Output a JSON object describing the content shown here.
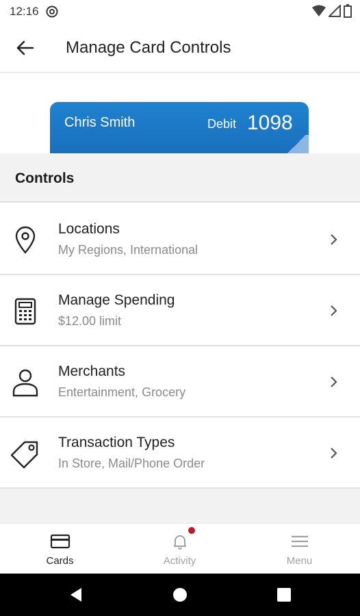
{
  "status_bar": {
    "time": "12:16"
  },
  "header": {
    "title": "Manage Card Controls"
  },
  "card": {
    "holder": "Chris Smith",
    "type": "Debit",
    "last4": "1098",
    "color": "#1f82cf"
  },
  "controls": {
    "heading": "Controls"
  },
  "items": [
    {
      "title": "Locations",
      "subtitle": "My Regions, International",
      "icon": "location-pin-icon"
    },
    {
      "title": "Manage Spending",
      "subtitle": "$12.00 limit",
      "icon": "calculator-icon"
    },
    {
      "title": "Merchants",
      "subtitle": "Entertainment, Grocery",
      "icon": "person-icon"
    },
    {
      "title": "Transaction Types",
      "subtitle": "In Store, Mail/Phone Order",
      "icon": "tag-icon"
    }
  ],
  "bottom_nav": [
    {
      "label": "Cards",
      "icon": "card-icon",
      "active": true
    },
    {
      "label": "Activity",
      "icon": "bell-icon",
      "active": false
    },
    {
      "label": "Menu",
      "icon": "hamburger-icon",
      "active": false
    }
  ],
  "colors": {
    "notification_dot": "#c0182c",
    "card_blue": "#1f82cf"
  }
}
